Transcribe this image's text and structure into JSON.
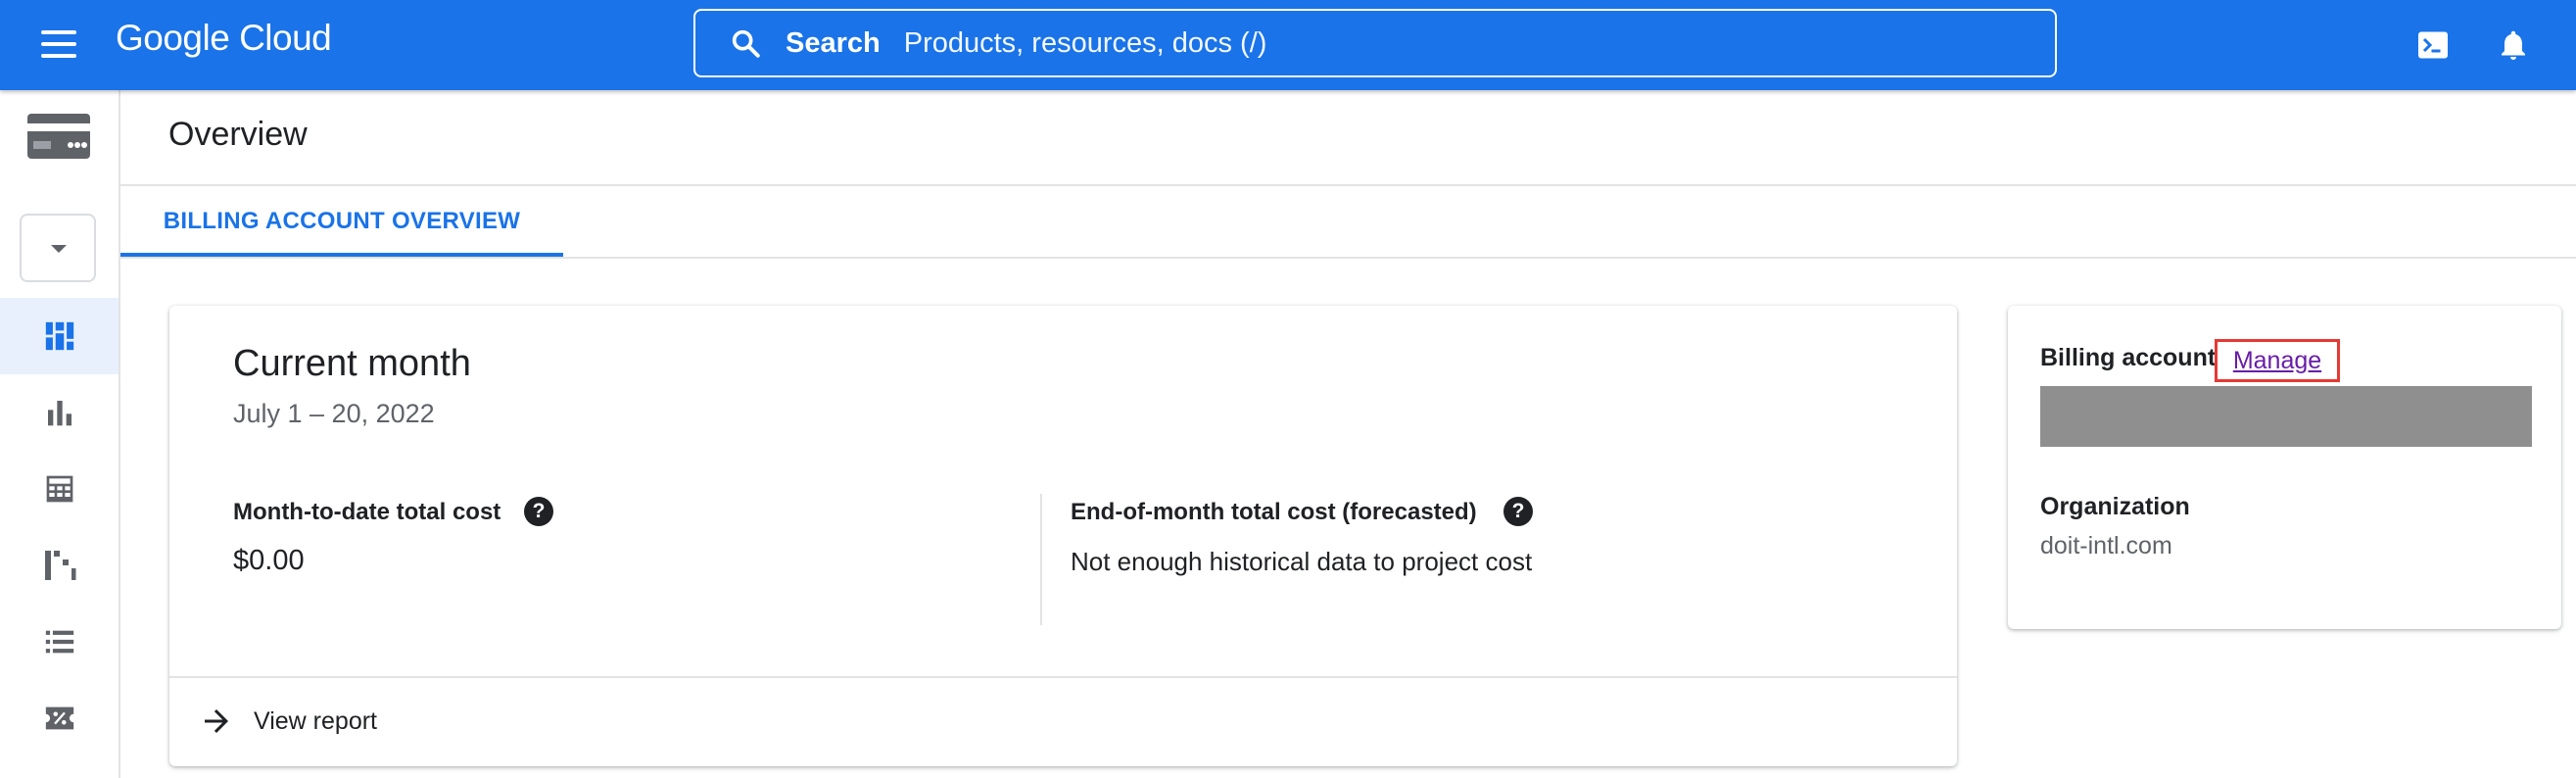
{
  "header": {
    "logo_text": "Google Cloud",
    "search_label": "Search",
    "search_placeholder": "Products, resources, docs (/)",
    "icons": [
      "menu-icon",
      "search-icon",
      "cloud-shell-icon",
      "notifications-icon"
    ]
  },
  "rail": {
    "icons": [
      "billing-card-icon",
      "overview-icon",
      "reports-icon",
      "calculator-icon",
      "budgets-icon",
      "list-icon",
      "discount-icon"
    ]
  },
  "page": {
    "title": "Overview",
    "tab_label": "BILLING ACCOUNT OVERVIEW"
  },
  "current_month": {
    "title": "Current month",
    "date_range": "July 1 – 20, 2022",
    "mtd_label": "Month-to-date total cost",
    "mtd_value": "$0.00",
    "eom_label": "End-of-month total cost (forecasted)",
    "eom_value": "Not enough historical data to project cost",
    "help_glyph": "?",
    "view_report": "View report"
  },
  "billing_account": {
    "label": "Billing account",
    "manage_link": "Manage",
    "org_label": "Organization",
    "org_value": "doit-intl.com"
  },
  "colors": {
    "brand_blue": "#1a73e8",
    "link_visited": "#681da8",
    "highlight_red": "#e53935",
    "redaction_gray": "#8f8f8f"
  }
}
